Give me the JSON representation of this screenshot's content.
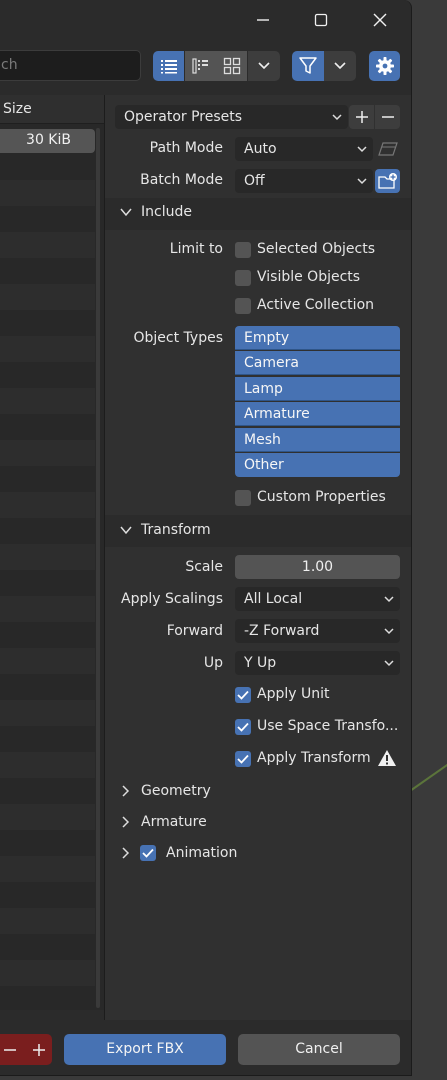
{
  "search": {
    "placeholder": "ch"
  },
  "file_list": {
    "size_header": "Size",
    "rows": [
      {
        "size": "30 KiB"
      }
    ]
  },
  "presets": {
    "label": "Operator Presets"
  },
  "path_mode": {
    "label": "Path Mode",
    "value": "Auto"
  },
  "batch_mode": {
    "label": "Batch Mode",
    "value": "Off"
  },
  "include": {
    "title": "Include",
    "limit_to_label": "Limit to",
    "limit_options": [
      {
        "label": "Selected Objects",
        "checked": false
      },
      {
        "label": "Visible Objects",
        "checked": false
      },
      {
        "label": "Active Collection",
        "checked": false
      }
    ],
    "object_types_label": "Object Types",
    "object_types": [
      "Empty",
      "Camera",
      "Lamp",
      "Armature",
      "Mesh",
      "Other"
    ],
    "custom_properties": {
      "label": "Custom Properties",
      "checked": false
    }
  },
  "transform": {
    "title": "Transform",
    "scale_label": "Scale",
    "scale_value": "1.00",
    "apply_scalings_label": "Apply Scalings",
    "apply_scalings_value": "All Local",
    "forward_label": "Forward",
    "forward_value": "-Z Forward",
    "up_label": "Up",
    "up_value": "Y Up",
    "apply_unit": {
      "label": "Apply Unit",
      "checked": true
    },
    "use_space_transform": {
      "label": "Use Space Transfo...",
      "checked": true
    },
    "apply_transform": {
      "label": "Apply Transform",
      "checked": true
    }
  },
  "collapsed_sections": {
    "geometry": "Geometry",
    "armature": "Armature",
    "animation": "Animation"
  },
  "buttons": {
    "export": "Export FBX",
    "cancel": "Cancel"
  },
  "colors": {
    "accent": "#4772b3",
    "panel": "#303030",
    "window": "#2b2b2b"
  }
}
